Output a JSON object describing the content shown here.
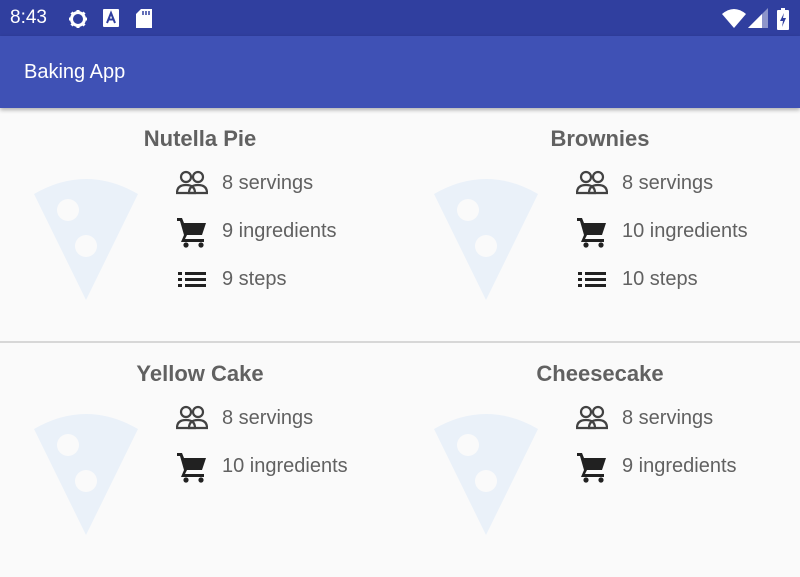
{
  "status_bar": {
    "time": "8:43",
    "icons": [
      "settings-icon",
      "font-icon",
      "sd-card-icon",
      "wifi-icon",
      "signal-icon",
      "battery-charging-icon"
    ]
  },
  "app_bar": {
    "title": "Baking App"
  },
  "recipes": [
    {
      "name": "Nutella Pie",
      "servings": "8 servings",
      "ingredients": "9 ingredients",
      "steps": "9 steps"
    },
    {
      "name": "Brownies",
      "servings": "8 servings",
      "ingredients": "10 ingredients",
      "steps": "10 steps"
    },
    {
      "name": "Yellow Cake",
      "servings": "8 servings",
      "ingredients": "10 ingredients"
    },
    {
      "name": "Cheesecake",
      "servings": "8 servings",
      "ingredients": "9 ingredients"
    }
  ],
  "colors": {
    "status_bar": "#303f9f",
    "app_bar": "#3f51b5",
    "text": "#616161",
    "watermark": "#eaf1f9"
  }
}
